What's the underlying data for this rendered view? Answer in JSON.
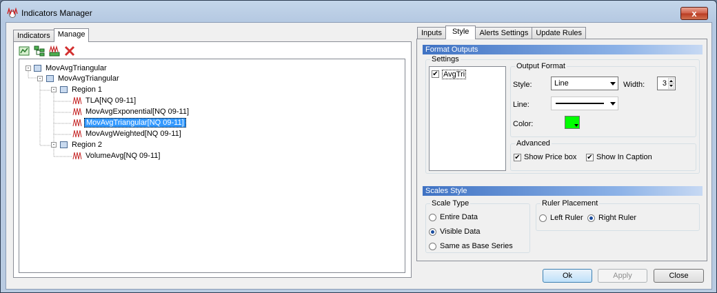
{
  "window": {
    "title": "Indicators Manager",
    "close_symbol": "x"
  },
  "left_tabs": [
    {
      "label": "Indicators"
    },
    {
      "label": "Manage"
    }
  ],
  "toolbar": [
    {
      "icon": "add-indicator-icon"
    },
    {
      "icon": "tree-icon"
    },
    {
      "icon": "indicator-icon"
    },
    {
      "icon": "delete-icon"
    }
  ],
  "tree": {
    "root": "MovAvgTriangular",
    "child": "MovAvgTriangular",
    "region1": "Region 1",
    "items1": [
      "TLA[NQ 09-11]",
      "MovAvgExponential[NQ 09-11]",
      "MovAvgTriangular[NQ 09-11]",
      "MovAvgWeighted[NQ 09-11]"
    ],
    "region2": "Region 2",
    "items2": [
      "VolumeAvg[NQ 09-11]"
    ],
    "expander_symbol": "-"
  },
  "right_tabs": [
    {
      "label": "Inputs"
    },
    {
      "label": "Style"
    },
    {
      "label": "Alerts Settings"
    },
    {
      "label": "Update Rules"
    }
  ],
  "format_outputs": {
    "header": "Format Outputs",
    "settings_label": "Settings",
    "settings_item": "AvgTri",
    "check": "✔",
    "output_format_label": "Output Format",
    "style_label": "Style:",
    "style_value": "Line",
    "width_label": "Width:",
    "width_value": "3",
    "line_label": "Line:",
    "color_label": "Color:",
    "color_value": "#00ff00",
    "advanced_label": "Advanced",
    "show_price_box": "Show Price box",
    "show_in_caption": "Show In Caption"
  },
  "scales_style": {
    "header": "Scales Style",
    "scale_type_label": "Scale Type",
    "options": [
      "Entire Data",
      "Visible Data",
      "Same as Base Series"
    ],
    "selected": "Visible Data",
    "ruler_label": "Ruler Placement",
    "ruler_options": [
      "Left Ruler",
      "Right Ruler"
    ],
    "ruler_selected": "Right Ruler"
  },
  "buttons": {
    "ok": "Ok",
    "apply": "Apply",
    "close": "Close"
  }
}
